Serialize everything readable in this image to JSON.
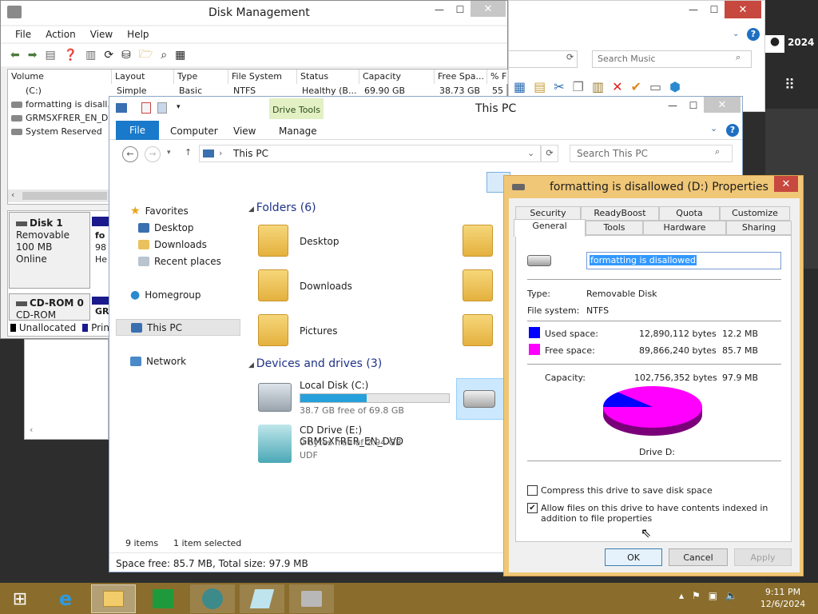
{
  "music_window": {
    "search_placeholder": "Search Music"
  },
  "disk_mgmt": {
    "title": "Disk Management",
    "menu": [
      "File",
      "Action",
      "View",
      "Help"
    ],
    "columns": [
      "Volume",
      "Layout",
      "Type",
      "File System",
      "Status",
      "Capacity",
      "Free Spa...",
      "% F"
    ],
    "rows": [
      {
        "volume": "(C:)",
        "layout": "Simple",
        "type": "Basic",
        "fs": "NTFS",
        "status": "Healthy (B...",
        "capacity": "69.90 GB",
        "free": "38.73 GB",
        "pct": "55"
      },
      {
        "volume": "formatting is disall..."
      },
      {
        "volume": "GRMSXFRER_EN_D..."
      },
      {
        "volume": "System Reserved"
      }
    ],
    "disk1": {
      "name": "Disk 1",
      "type": "Removable",
      "size": "100 MB",
      "status": "Online",
      "part_lines": [
        "fo",
        "98",
        "He"
      ]
    },
    "cdrom": {
      "name": "CD-ROM 0",
      "type": "CD-ROM",
      "part_line": "GR"
    },
    "legend": {
      "unallocated": "Unallocated",
      "primary": "Prin"
    }
  },
  "explorer": {
    "title": "This PC",
    "context_tab": "Drive Tools",
    "ribbon_tabs": [
      "File",
      "Computer",
      "View",
      "Manage"
    ],
    "address": "This PC",
    "search_placeholder": "Search This PC",
    "nav": {
      "favorites": "Favorites",
      "desktop": "Desktop",
      "downloads": "Downloads",
      "recent": "Recent places",
      "homegroup": "Homegroup",
      "thispc": "This PC",
      "network": "Network"
    },
    "folders_header": "Folders (6)",
    "folders": [
      "Desktop",
      "Downloads",
      "Pictures"
    ],
    "devices_header": "Devices and drives (3)",
    "drives": [
      {
        "name": "Local Disk (C:)",
        "detail": "38.7 GB free of 69.8 GB",
        "fill": 0.445
      },
      {
        "name": "CD Drive (E:) GRMSXFRER_EN_DVD",
        "detail1": "0 bytes free of 2.94 GB",
        "detail2": "UDF"
      }
    ],
    "status_items": "9 items",
    "status_selected": "1 item selected",
    "details_bar": "Space free: 85.7 MB, Total size: 97.9 MB"
  },
  "props": {
    "title": "formatting is disallowed (D:) Properties",
    "tabs_back": [
      "Security",
      "ReadyBoost",
      "Quota",
      "Customize"
    ],
    "tabs_front": [
      "General",
      "Tools",
      "Hardware",
      "Sharing"
    ],
    "label_value": "formatting is disallowed",
    "type_label": "Type:",
    "type_value": "Removable Disk",
    "fs_label": "File system:",
    "fs_value": "NTFS",
    "used_label": "Used space:",
    "used_bytes": "12,890,112 bytes",
    "used_size": "12.2 MB",
    "free_label": "Free space:",
    "free_bytes": "89,866,240 bytes",
    "free_size": "85.7 MB",
    "cap_label": "Capacity:",
    "cap_bytes": "102,756,352 bytes",
    "cap_size": "97.9 MB",
    "drive_label": "Drive D:",
    "used_fraction": 0.1254,
    "compress_label": "Compress this drive to save disk space",
    "compress_checked": false,
    "index_label": "Allow files on this drive to have contents indexed in addition to file properties",
    "index_checked": true,
    "ok": "OK",
    "cancel": "Cancel",
    "apply": "Apply",
    "colors": {
      "used": "#0000ff",
      "free": "#ff00ff"
    }
  },
  "taskbar": {
    "time": "9:11 PM",
    "date": "12/6/2024"
  }
}
